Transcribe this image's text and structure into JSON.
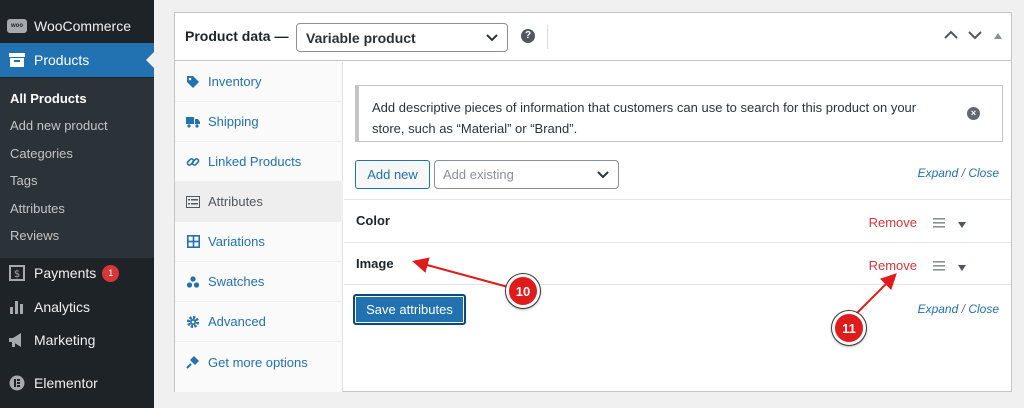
{
  "sidebar": {
    "woocommerce": "WooCommerce",
    "woo_logo": "woo",
    "products": "Products",
    "submenu": [
      "All Products",
      "Add new product",
      "Categories",
      "Tags",
      "Attributes",
      "Reviews"
    ],
    "payments": "Payments",
    "payments_badge": "1",
    "analytics": "Analytics",
    "marketing": "Marketing",
    "elementor": "Elementor"
  },
  "header": {
    "title": "Product data —",
    "product_type": "Variable product",
    "help": "?"
  },
  "tabs": [
    "Inventory",
    "Shipping",
    "Linked Products",
    "Attributes",
    "Variations",
    "Swatches",
    "Advanced",
    "Get more options"
  ],
  "notice": {
    "text": "Add descriptive pieces of information that customers can use to search for this product on your store, such as “Material” or “Brand”.",
    "close": "×"
  },
  "toolbar": {
    "add_new": "Add new",
    "add_existing_placeholder": "Add existing",
    "expand": "Expand",
    "sep": "/",
    "close": "Close"
  },
  "attributes": [
    {
      "name": "Color",
      "remove": "Remove"
    },
    {
      "name": "Image",
      "remove": "Remove"
    }
  ],
  "save_button": "Save attributes",
  "callouts": [
    "10",
    "11"
  ],
  "colors": {
    "accent": "#2271b1",
    "danger": "#d63638",
    "sidebar": "#1d2327",
    "callout": "#e01b1b"
  }
}
